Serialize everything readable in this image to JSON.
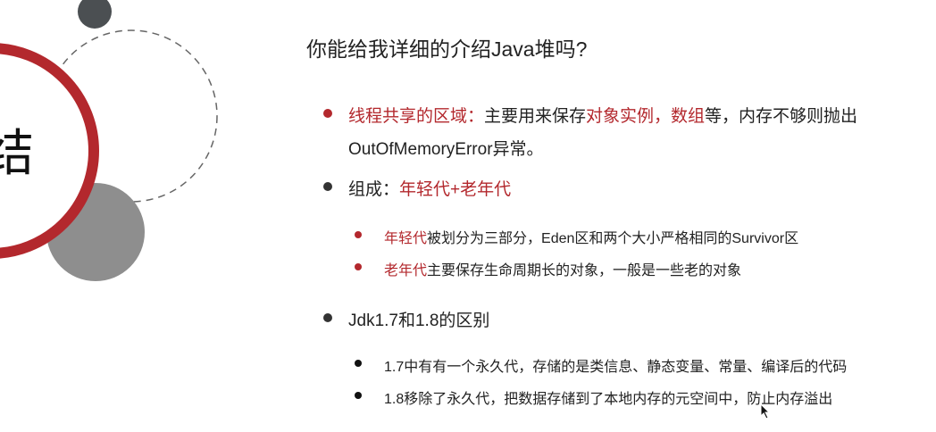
{
  "side": {
    "label": "结"
  },
  "title": "你能给我详细的介绍Java堆吗?",
  "colors": {
    "accent": "#b3282d",
    "dark": "#4b4f52",
    "gray": "#8e8e8e"
  },
  "bullets": [
    {
      "parts": [
        {
          "text": "线程共享的区域：",
          "red": true
        },
        {
          "text": "主要用来保存"
        },
        {
          "text": "对象实例，数组",
          "red": true
        },
        {
          "text": "等，内存不够则抛出"
        }
      ],
      "line2": "OutOfMemoryError异常。"
    },
    {
      "parts": [
        {
          "text": "组成："
        },
        {
          "text": "年轻代+老年代",
          "red": true
        }
      ]
    },
    {
      "parts": [
        {
          "text": "年轻代",
          "red": true
        },
        {
          "text": "被划分为三部分，Eden区和两个大小严格相同的Survivor区"
        }
      ]
    },
    {
      "parts": [
        {
          "text": "老年代",
          "red": true
        },
        {
          "text": "主要保存生命周期长的对象，一般是一些老的对象"
        }
      ]
    },
    {
      "parts": [
        {
          "text": "Jdk1.7和1.8的区别"
        }
      ]
    },
    {
      "parts": [
        {
          "text": "1.7中有有一个永久代，存储的是类信息、静态变量、常量、编译后的代码"
        }
      ]
    },
    {
      "parts": [
        {
          "text": "1.8移除了永久代，把数据存储到了本地内存的元空间中，防止内存溢出"
        }
      ]
    }
  ]
}
